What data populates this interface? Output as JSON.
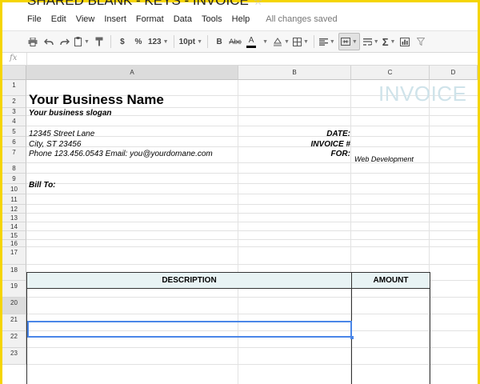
{
  "document": {
    "title": "SHARED BLANK - KEYS - INVOICE",
    "star_icon": "star-icon"
  },
  "menu": {
    "items": [
      "File",
      "Edit",
      "View",
      "Insert",
      "Format",
      "Data",
      "Tools",
      "Help"
    ],
    "save_status": "All changes saved"
  },
  "toolbar": {
    "currency": "$",
    "percent": "%",
    "number_format": "123",
    "font_size": "10pt",
    "bold": "B",
    "strikethrough": "Abc",
    "text_color_letter": "A",
    "text_color_accent": "#000000"
  },
  "formula_bar": {
    "fx_label": "fx",
    "value": ""
  },
  "columns": [
    "A",
    "B",
    "C",
    "D"
  ],
  "rows": [
    "1",
    "2",
    "3",
    "4",
    "5",
    "6",
    "7",
    "8",
    "9",
    "10",
    "11",
    "12",
    "13",
    "14",
    "15",
    "16",
    "17",
    "18",
    "19",
    "20",
    "21",
    "22",
    "23"
  ],
  "selected_row": "20",
  "selected_column": "A",
  "sheet": {
    "business_name": "Your Business Name",
    "business_slogan": "Your business slogan",
    "street": "12345 Street Lane",
    "city": "City, ST 23456",
    "contact": "Phone 123.456.0543 Email: you@yourdomane.com",
    "date_label": "DATE:",
    "invoice_label": "INVOICE #",
    "for_label": "FOR:",
    "for_value": "Web Development",
    "invoice_title": "INVOICE",
    "bill_to_label": "Bill To:",
    "table_headers": {
      "description": "DESCRIPTION",
      "amount": "AMOUNT"
    }
  },
  "colors": {
    "frame": "#f5d500",
    "table_header_bg": "#e8f3f4",
    "invoice_title": "#cfe3ea",
    "selection": "#4a86e8"
  }
}
